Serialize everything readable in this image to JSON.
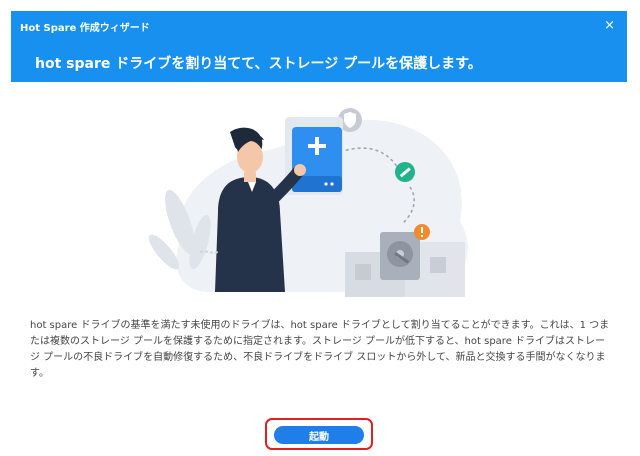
{
  "window": {
    "title": "Hot Spare 作成ウィザード",
    "close_label": "×",
    "subtitle": "hot spare ドライブを割り当てて、ストレージ プールを保護します。"
  },
  "colors": {
    "header_bg": "#1890ef",
    "button_bg": "#1f7ee8",
    "highlight_border": "#e02020"
  },
  "illustration": {
    "icons": [
      "person-icon",
      "add-drive-icon",
      "shield-icon",
      "wrench-icon",
      "warning-icon",
      "failed-drive-icon"
    ]
  },
  "description": "hot spare ドライブの基準を満たす未使用のドライブは、hot spare ドライブとして割り当てることができます。これは、1 つまたは複数のストレージ プールを保護するために指定されます。ストレージ プールが低下すると、hot spare ドライブはストレージ プールの不良ドライブを自動修復するため、不良ドライブをドライブ スロットから外して、新品と交換する手間がなくなります。",
  "actions": {
    "start_label": "起動"
  }
}
